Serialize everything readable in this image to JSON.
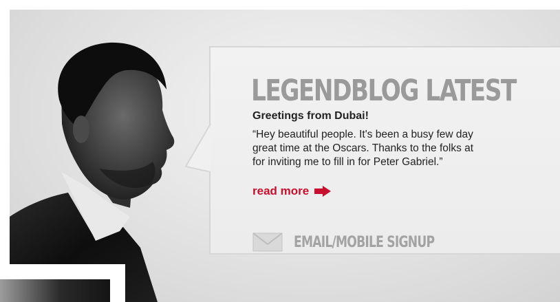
{
  "blog": {
    "heading": "LEGENDBLOG LATEST",
    "post_title": "Greetings from Dubai!",
    "excerpt_lines": [
      "“Hey beautiful people.  It's been a busy few day",
      "great time at the Oscars.  Thanks to the folks at",
      "for inviting me to fill in for Peter Gabriel.”"
    ],
    "read_more_label": "read more",
    "accent_color": "#c8102e"
  },
  "signup": {
    "label": "EMAIL/MOBILE SIGNUP",
    "icon": "envelope-icon"
  },
  "icons": {
    "read_more_arrow": "arrow-right-icon"
  }
}
